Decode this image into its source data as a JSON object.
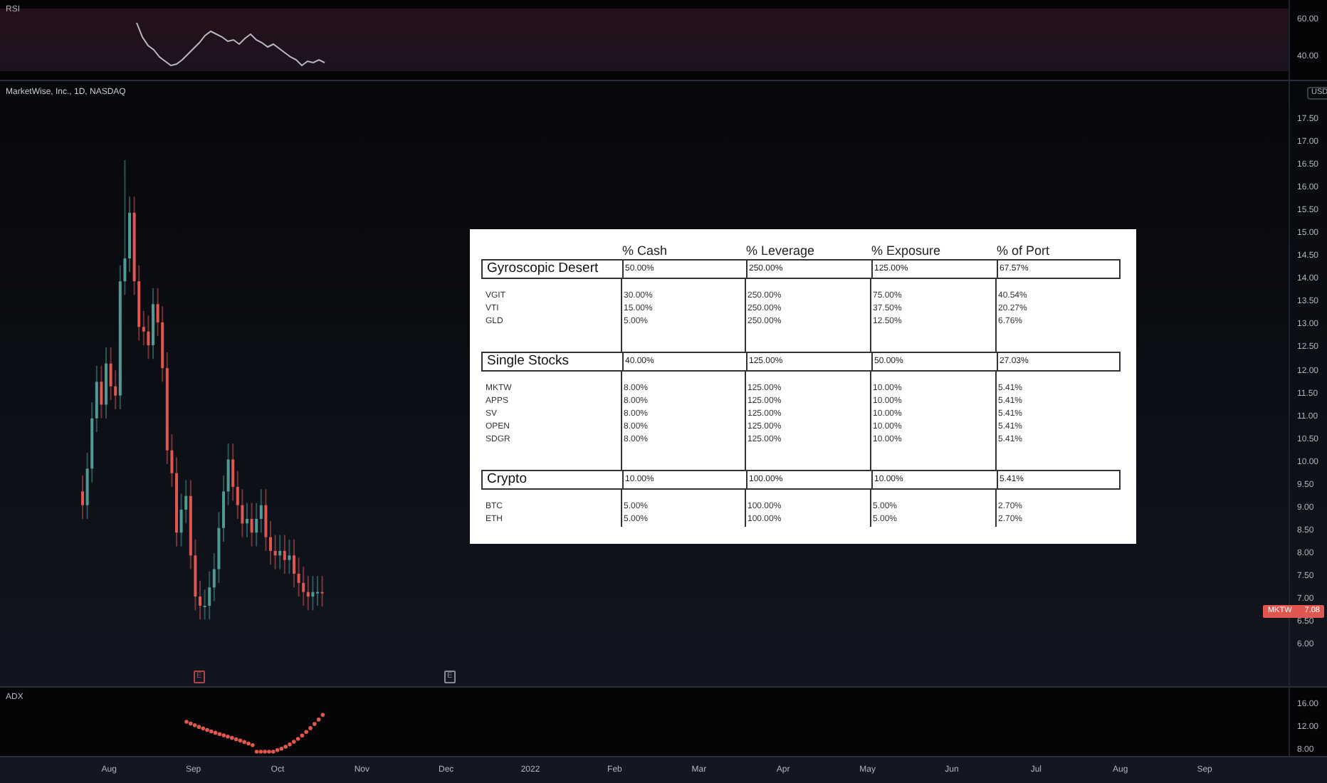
{
  "rsi_pane": {
    "label": "RSI",
    "axis_labels": [
      "60.00",
      "40.00"
    ]
  },
  "main_pane": {
    "legend": "MarketWise, Inc., 1D, NASDAQ",
    "currency": "USD",
    "axis_labels": [
      "17.50",
      "17.00",
      "16.50",
      "16.00",
      "15.50",
      "15.00",
      "14.50",
      "14.00",
      "13.50",
      "13.00",
      "12.50",
      "12.00",
      "11.50",
      "11.00",
      "10.50",
      "10.00",
      "9.50",
      "9.00",
      "8.50",
      "8.00",
      "7.50",
      "7.00",
      "6.50",
      "6.00"
    ],
    "price_tag": {
      "symbol": "MKTW",
      "value": "7.08"
    },
    "event_markers": [
      {
        "label": "E",
        "color": "#b2434a"
      },
      {
        "label": "E",
        "color": "#8a8d96"
      }
    ]
  },
  "table": {
    "columns": [
      "% Cash",
      "% Leverage",
      "% Exposure",
      "% of Port"
    ],
    "groups": [
      {
        "name": "Gyroscopic Desert",
        "values": [
          "50.00%",
          "250.00%",
          "125.00%",
          "67.57%"
        ],
        "rows": [
          {
            "name": "VGIT",
            "values": [
              "30.00%",
              "250.00%",
              "75.00%",
              "40.54%"
            ]
          },
          {
            "name": "VTI",
            "values": [
              "15.00%",
              "250.00%",
              "37.50%",
              "20.27%"
            ]
          },
          {
            "name": "GLD",
            "values": [
              "5.00%",
              "250.00%",
              "12.50%",
              "6.76%"
            ]
          }
        ]
      },
      {
        "name": "Single Stocks",
        "values": [
          "40.00%",
          "125.00%",
          "50.00%",
          "27.03%"
        ],
        "rows": [
          {
            "name": "MKTW",
            "values": [
              "8.00%",
              "125.00%",
              "10.00%",
              "5.41%"
            ]
          },
          {
            "name": "APPS",
            "values": [
              "8.00%",
              "125.00%",
              "10.00%",
              "5.41%"
            ]
          },
          {
            "name": "SV",
            "values": [
              "8.00%",
              "125.00%",
              "10.00%",
              "5.41%"
            ]
          },
          {
            "name": "OPEN",
            "values": [
              "8.00%",
              "125.00%",
              "10.00%",
              "5.41%"
            ]
          },
          {
            "name": "SDGR",
            "values": [
              "8.00%",
              "125.00%",
              "10.00%",
              "5.41%"
            ]
          }
        ]
      },
      {
        "name": "Crypto",
        "values": [
          "10.00%",
          "100.00%",
          "10.00%",
          "5.41%"
        ],
        "rows": [
          {
            "name": "BTC",
            "values": [
              "5.00%",
              "100.00%",
              "5.00%",
              "2.70%"
            ]
          },
          {
            "name": "ETH",
            "values": [
              "5.00%",
              "100.00%",
              "5.00%",
              "2.70%"
            ]
          }
        ]
      }
    ]
  },
  "adx_pane": {
    "label": "ADX",
    "axis_labels": [
      "16.00",
      "12.00",
      "8.00"
    ]
  },
  "time_axis": [
    "Aug",
    "Sep",
    "Oct",
    "Nov",
    "Dec",
    "2022",
    "Feb",
    "Mar",
    "Apr",
    "May",
    "Jun",
    "Jul",
    "Aug",
    "Sep"
  ]
}
